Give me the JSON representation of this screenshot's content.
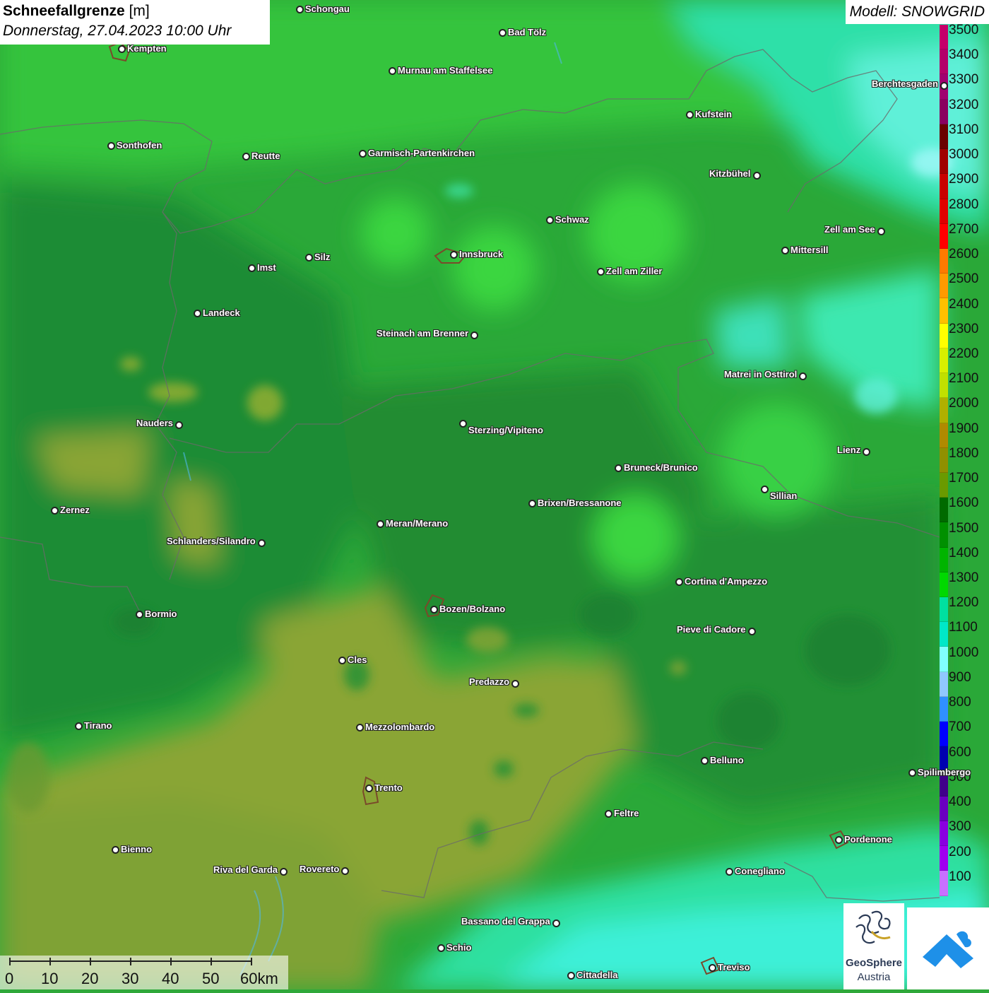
{
  "header": {
    "title_bold": "Schneefallgrenze",
    "title_unit": " [m]",
    "datetime": "Donnerstag, 27.04.2023 10:00 Uhr",
    "model": "Modell: SNOWGRID"
  },
  "legend": {
    "labels": [
      "3500",
      "3400",
      "3300",
      "3200",
      "3100",
      "3000",
      "2900",
      "2800",
      "2700",
      "2600",
      "2500",
      "2400",
      "2300",
      "2200",
      "2100",
      "2000",
      "1900",
      "1800",
      "1700",
      "1600",
      "1500",
      "1400",
      "1300",
      "1200",
      "1100",
      "1000",
      "900",
      "800",
      "700",
      "600",
      "500",
      "400",
      "300",
      "200",
      "100"
    ],
    "colors": [
      "#c4006a",
      "#b3006a",
      "#a00070",
      "#8a0060",
      "#6a0000",
      "#a00000",
      "#c80000",
      "#e00000",
      "#ff0000",
      "#ff7a00",
      "#ff9a00",
      "#ffc000",
      "#ffff00",
      "#d8f000",
      "#c0e000",
      "#b0b000",
      "#b08a00",
      "#909000",
      "#6a9a00",
      "#006a00",
      "#009000",
      "#00b400",
      "#00d800",
      "#00e0a0",
      "#00e8c8",
      "#80ffff",
      "#90c8ff",
      "#3090ff",
      "#0000ff",
      "#0000b0",
      "#40008a",
      "#6a00c0",
      "#8a00e0",
      "#a000f0",
      "#c870ff"
    ]
  },
  "cities": [
    {
      "name": "Schongau"
    },
    {
      "name": "Bad Tölz"
    },
    {
      "name": "Kempten"
    },
    {
      "name": "Murnau am Staffelsee"
    },
    {
      "name": "Berchtesgaden"
    },
    {
      "name": "Kufstein"
    },
    {
      "name": "Sonthofen"
    },
    {
      "name": "Reutte"
    },
    {
      "name": "Garmisch-Partenkirchen"
    },
    {
      "name": "Kitzbühel"
    },
    {
      "name": "Schwaz"
    },
    {
      "name": "Zell am See"
    },
    {
      "name": "Innsbruck"
    },
    {
      "name": "Mittersill"
    },
    {
      "name": "Imst"
    },
    {
      "name": "Silz"
    },
    {
      "name": "Zell am Ziller"
    },
    {
      "name": "Landeck"
    },
    {
      "name": "Steinach am Brenner"
    },
    {
      "name": "Matrei in Osttirol"
    },
    {
      "name": "Nauders"
    },
    {
      "name": "Sterzing/Vipiteno"
    },
    {
      "name": "Lienz"
    },
    {
      "name": "Bruneck/Brunico"
    },
    {
      "name": "Sillian"
    },
    {
      "name": "Brixen/Bressanone"
    },
    {
      "name": "Zernez"
    },
    {
      "name": "Meran/Merano"
    },
    {
      "name": "Schlanders/Silandro"
    },
    {
      "name": "Cortina d'Ampezzo"
    },
    {
      "name": "Bozen/Bolzano"
    },
    {
      "name": "Bormio"
    },
    {
      "name": "Pieve di Cadore"
    },
    {
      "name": "Cles"
    },
    {
      "name": "Predazzo"
    },
    {
      "name": "Tirano"
    },
    {
      "name": "Mezzolombardo"
    },
    {
      "name": "Belluno"
    },
    {
      "name": "Spilimbergo"
    },
    {
      "name": "Trento"
    },
    {
      "name": "Feltre"
    },
    {
      "name": "Pordenone"
    },
    {
      "name": "Bienno"
    },
    {
      "name": "Riva del Garda"
    },
    {
      "name": "Rovereto"
    },
    {
      "name": "Conegliano"
    },
    {
      "name": "Bassano del Grappa"
    },
    {
      "name": "Schio"
    },
    {
      "name": "Treviso"
    },
    {
      "name": "Cittadella"
    }
  ],
  "scalebar": {
    "ticks": [
      "0",
      "10",
      "20",
      "30",
      "40",
      "50",
      "60km"
    ]
  },
  "logos": {
    "geosphere_line1": "GeoSphere",
    "geosphere_line2": "Austria"
  }
}
